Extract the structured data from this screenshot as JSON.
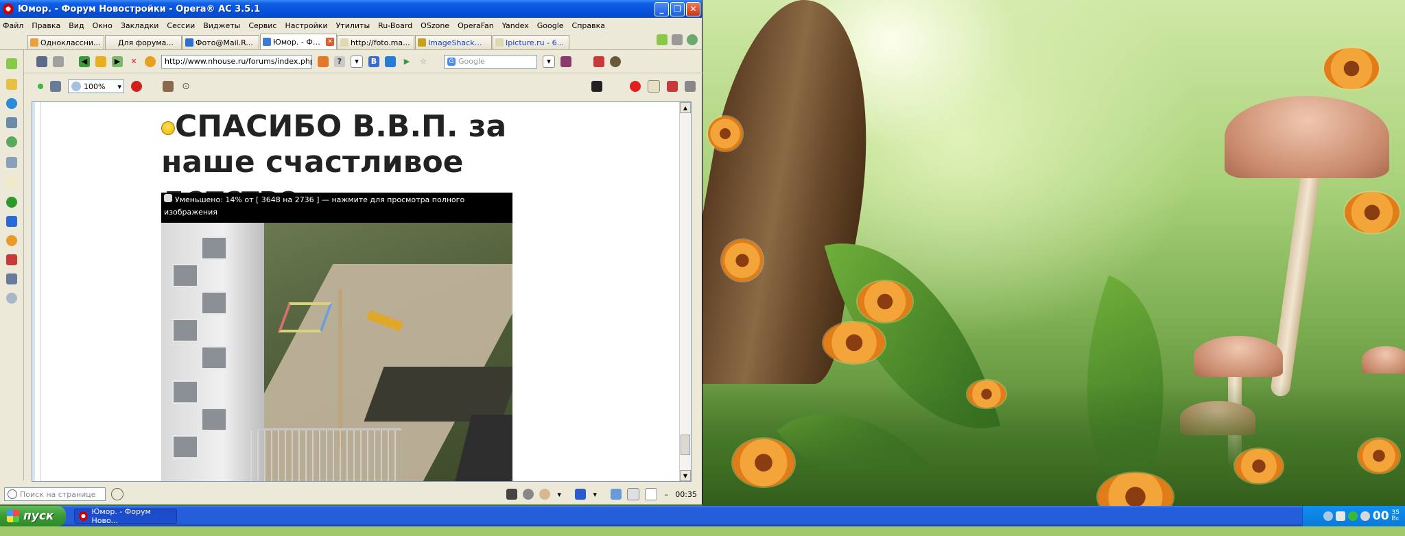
{
  "window": {
    "title": "Юмор. - Форум Новостройки - Opera® AC 3.5.1",
    "minimize_glyph": "_",
    "maximize_glyph": "❐",
    "close_glyph": "✕"
  },
  "menu": [
    "Файл",
    "Правка",
    "Вид",
    "Окно",
    "Закладки",
    "Сессии",
    "Виджеты",
    "Сервис",
    "Настройки",
    "Утилиты",
    "Ru-Board",
    "OSzone",
    "OperaFan",
    "Yandex",
    "Google",
    "Справка"
  ],
  "tabs": [
    {
      "label": "Одноклассни...",
      "icon": "page-icon",
      "active": false,
      "link": false
    },
    {
      "label": "Для форума...",
      "icon": "page-icon",
      "active": false,
      "link": false
    },
    {
      "label": "Фото@Mail.R...",
      "icon": "mail-icon",
      "active": false,
      "link": false
    },
    {
      "label": "Юмор. - Фору...",
      "icon": "forum-icon",
      "active": true,
      "link": false
    },
    {
      "label": "http://foto.ma...",
      "icon": "page-icon",
      "active": false,
      "link": false
    },
    {
      "label": "ImageShack®...",
      "icon": "imageshack-icon",
      "active": false,
      "link": true
    },
    {
      "label": "Ipicture.ru - 6...",
      "icon": "page-icon",
      "active": false,
      "link": true
    }
  ],
  "navigation": {
    "address": "http://www.nhouse.ru/forums/index.php",
    "search_placeholder": "Google"
  },
  "view": {
    "zoom": "100%"
  },
  "post": {
    "title": "СПАСИБО В.В.П. за наше счастливое детство",
    "resize_notice": "Уменьшено: 14% от [ 3648 на 2736 ] — нажмите для просмотра полного изображения"
  },
  "statusbar": {
    "find_placeholder": "Поиск на странице",
    "time": "00:35"
  },
  "taskbar": {
    "start_label": "пуск",
    "task_label": "Юмор. - Форум Ново...",
    "clock_hour": "00",
    "clock_min": "35",
    "clock_day": "Вс"
  },
  "colors": {
    "titlebar": "#0550d8",
    "taskbar": "#245edb",
    "start": "#3a9a34",
    "accent_link": "#1a3fc8"
  }
}
